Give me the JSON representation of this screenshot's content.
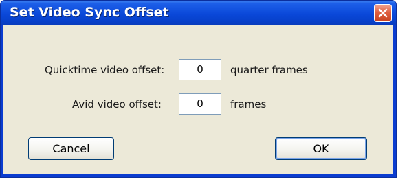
{
  "dialog": {
    "title": "Set Video Sync Offset",
    "close_icon": "close-icon"
  },
  "fields": {
    "quicktime": {
      "label": "Quicktime video offset:",
      "value": "0",
      "unit": "quarter frames"
    },
    "avid": {
      "label": "Avid video offset:",
      "value": "0",
      "unit": "frames"
    }
  },
  "buttons": {
    "cancel": "Cancel",
    "ok": "OK"
  },
  "colors": {
    "titlebar": "#0a48d9",
    "client_bg": "#ece9d8",
    "close_button": "#e06040"
  }
}
